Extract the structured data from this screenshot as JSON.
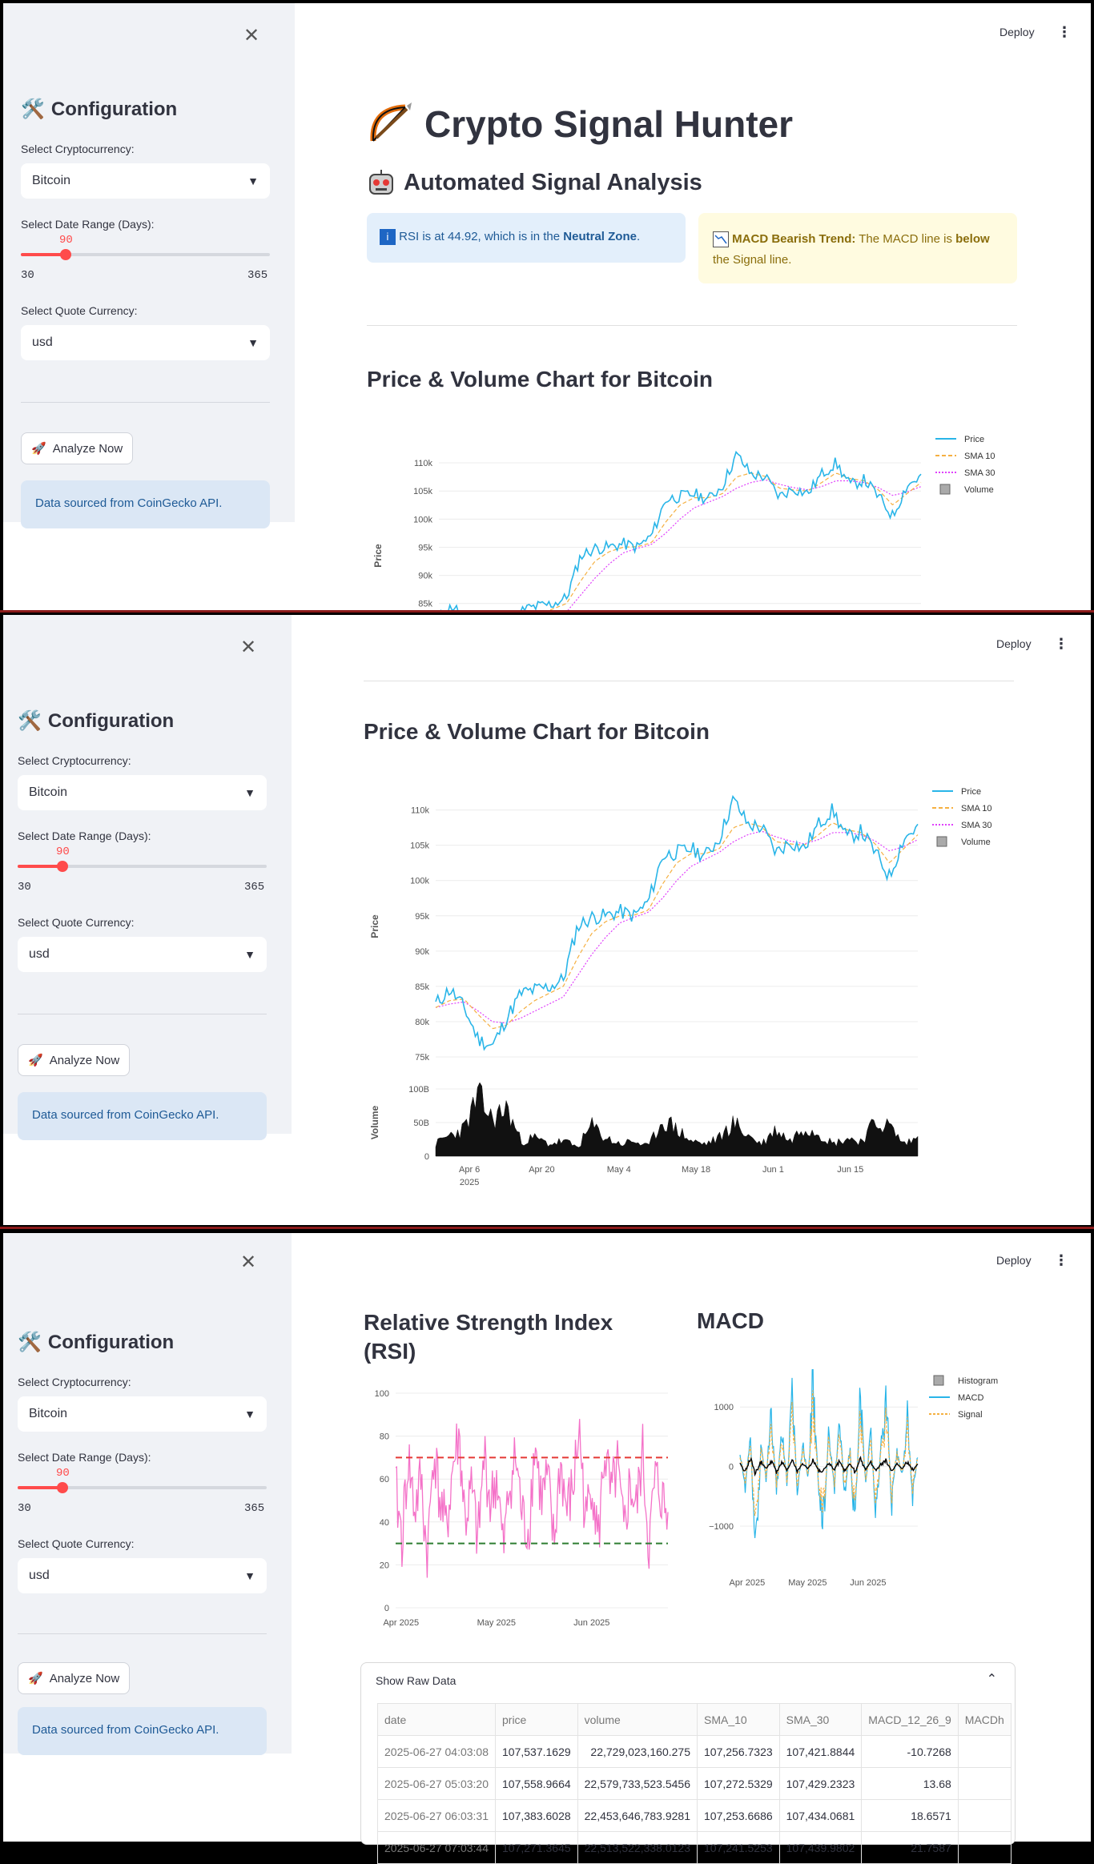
{
  "sidebar": {
    "title": "Configuration",
    "crypto_label": "Select Cryptocurrency:",
    "crypto_value": "Bitcoin",
    "range_label": "Select Date Range (Days):",
    "range_value": "90",
    "range_min": "30",
    "range_max": "365",
    "quote_label": "Select Quote Currency:",
    "quote_value": "usd",
    "analyze_button": "Analyze Now",
    "info": "Data sourced from CoinGecko API.",
    "close_icon": "close-icon"
  },
  "header": {
    "deploy": "Deploy",
    "menu_icon": "kebab-menu-icon"
  },
  "main": {
    "title": "Crypto Signal Hunter",
    "subtitle": "Automated Signal Analysis",
    "rsi_alert": {
      "pre": "RSI is at 44.92, which is in the ",
      "bold": "Neutral Zone",
      "post": "."
    },
    "macd_alert": {
      "bold": "MACD Bearish Trend:",
      "pre": " The MACD line is ",
      "bold2": "below",
      "post": " the Signal line."
    },
    "price_section_title": "Price & Volume Chart for Bitcoin",
    "rsi_title_line1": "Relative Strength Index",
    "rsi_title_line2": "(RSI)",
    "macd_title": "MACD"
  },
  "chart_data": [
    {
      "type": "line",
      "title": "Price & Volume Chart for Bitcoin",
      "ylabel": "Price",
      "ylim": [
        75000,
        112000
      ],
      "y_ticks": [
        "75k",
        "80k",
        "85k",
        "90k",
        "95k",
        "100k",
        "105k",
        "110k"
      ],
      "x_ticks": [
        "Apr 6",
        "Apr 20",
        "May 4",
        "May 18",
        "Jun 1",
        "Jun 15"
      ],
      "x_year": "2025",
      "legend": [
        "Price",
        "SMA 10",
        "SMA 30",
        "Volume"
      ],
      "legend_position": "top-right",
      "x": [
        "2025-03-29",
        "2025-04-01",
        "2025-04-04",
        "2025-04-06",
        "2025-04-08",
        "2025-04-09",
        "2025-04-12",
        "2025-04-15",
        "2025-04-18",
        "2025-04-21",
        "2025-04-22",
        "2025-04-25",
        "2025-04-28",
        "2025-05-01",
        "2025-05-04",
        "2025-05-06",
        "2025-05-08",
        "2025-05-11",
        "2025-05-14",
        "2025-05-17",
        "2025-05-20",
        "2025-05-22",
        "2025-05-25",
        "2025-05-28",
        "2025-05-31",
        "2025-06-03",
        "2025-06-05",
        "2025-06-08",
        "2025-06-10",
        "2025-06-13",
        "2025-06-16",
        "2025-06-19",
        "2025-06-22",
        "2025-06-24",
        "2025-06-27"
      ],
      "series": [
        {
          "name": "Price",
          "values": [
            82500,
            84600,
            82000,
            77500,
            76500,
            80500,
            84000,
            84500,
            84900,
            86000,
            93500,
            94800,
            95000,
            95600,
            95000,
            97000,
            103500,
            104000,
            104500,
            103500,
            106000,
            111500,
            108000,
            107500,
            104000,
            105500,
            104500,
            108000,
            110000,
            106000,
            107000,
            104000,
            100500,
            106000,
            107500
          ]
        },
        {
          "name": "SMA 10",
          "values": [
            82000,
            83000,
            83200,
            81000,
            79000,
            79500,
            81500,
            83000,
            84000,
            85000,
            89000,
            92500,
            94200,
            95000,
            95100,
            95800,
            99500,
            102500,
            103800,
            103800,
            104500,
            107500,
            108200,
            107600,
            105500,
            105200,
            105000,
            106500,
            108200,
            107200,
            106800,
            105200,
            102500,
            104500,
            106500
          ]
        },
        {
          "name": "SMA 30",
          "values": [
            82000,
            82500,
            82800,
            81500,
            80000,
            79800,
            80500,
            81500,
            82500,
            83500,
            86500,
            89500,
            92000,
            94000,
            94800,
            95500,
            97500,
            100000,
            102000,
            103000,
            104000,
            105500,
            106500,
            107000,
            106200,
            105600,
            105200,
            105800,
            106800,
            106800,
            106500,
            105600,
            104200,
            104800,
            105800
          ]
        }
      ],
      "volume": {
        "name": "Volume",
        "ylabel": "Volume",
        "ylim": [
          0,
          100
        ],
        "unit": "B",
        "y_ticks": [
          "0",
          "50B",
          "100B"
        ],
        "values": [
          20,
          35,
          45,
          98,
          60,
          80,
          25,
          30,
          20,
          25,
          15,
          50,
          30,
          20,
          25,
          15,
          60,
          45,
          25,
          20,
          30,
          55,
          35,
          20,
          45,
          25,
          50,
          40,
          20,
          30,
          25,
          55,
          50,
          20,
          30
        ]
      }
    },
    {
      "type": "line",
      "title": "Relative Strength Index (RSI)",
      "ylim": [
        0,
        100
      ],
      "y_ticks": [
        "0",
        "20",
        "40",
        "60",
        "80",
        "100"
      ],
      "x_ticks": [
        "Apr 2025",
        "May 2025",
        "Jun 2025"
      ],
      "overbought": 70,
      "oversold": 30,
      "series": [
        {
          "name": "RSI",
          "values": [
            55,
            32,
            70,
            45,
            60,
            22,
            75,
            50,
            35,
            65,
            80,
            40,
            55,
            30,
            72,
            48,
            62,
            25,
            58,
            70,
            42,
            35,
            78,
            50,
            60,
            28,
            68,
            45,
            55,
            85,
            38,
            62,
            30,
            74,
            50,
            66,
            33,
            58,
            45,
            72,
            28,
            60,
            52,
            40
          ]
        }
      ]
    },
    {
      "type": "line",
      "title": "MACD",
      "ylim": [
        -1700,
        1500
      ],
      "y_ticks": [
        "−1000",
        "0",
        "1000"
      ],
      "x_ticks": [
        "Apr 2025",
        "May 2025",
        "Jun 2025"
      ],
      "legend": [
        "Histogram",
        "MACD",
        "Signal"
      ],
      "legend_position": "top-right",
      "series": [
        {
          "name": "MACD",
          "values": [
            200,
            -300,
            500,
            -1600,
            300,
            -200,
            900,
            -400,
            600,
            -300,
            1300,
            -500,
            400,
            -200,
            1400,
            -300,
            -900,
            600,
            -400,
            900,
            -500,
            300,
            -1000,
            1200,
            -300,
            500,
            -900,
            400,
            1100,
            -600,
            300,
            -200,
            800,
            -500,
            200
          ]
        },
        {
          "name": "Signal",
          "values": [
            150,
            -200,
            350,
            -1100,
            250,
            -150,
            650,
            -300,
            450,
            -250,
            950,
            -350,
            300,
            -150,
            1000,
            -250,
            -650,
            450,
            -300,
            650,
            -350,
            250,
            -750,
            850,
            -250,
            350,
            -650,
            300,
            800,
            -450,
            250,
            -150,
            600,
            -350,
            150
          ]
        },
        {
          "name": "Histogram",
          "values": [
            50,
            -100,
            150,
            -150,
            100,
            -50,
            120,
            -100,
            80,
            -60,
            100,
            -80,
            60,
            -40,
            120,
            -70,
            -90,
            80,
            -60,
            100,
            -80,
            50,
            -100,
            120,
            -50,
            80,
            -90,
            60,
            100,
            -80,
            50,
            -40,
            90,
            -70,
            40
          ]
        }
      ]
    }
  ],
  "raw_data": {
    "toggle_label": "Show Raw Data",
    "columns": [
      "date",
      "price",
      "volume",
      "SMA_10",
      "SMA_30",
      "MACD_12_26_9",
      "MACDh"
    ],
    "rows": [
      [
        "2025-06-27 04:03:08",
        "107,537.1629",
        "22,729,023,160.275",
        "107,256.7323",
        "107,421.8844",
        "-10.7268",
        ""
      ],
      [
        "2025-06-27 05:03:20",
        "107,558.9664",
        "22,579,733,523.5456",
        "107,272.5329",
        "107,429.2323",
        "13.68",
        ""
      ],
      [
        "2025-06-27 06:03:31",
        "107,383.6028",
        "22,453,646,783.9281",
        "107,253.6686",
        "107,434.0681",
        "18.6571",
        ""
      ],
      [
        "2025-06-27 07:03:44",
        "107,271.3645",
        "22,513,522,338.0123",
        "107,241.5253",
        "107,439.9802",
        "21.7587",
        ""
      ]
    ]
  },
  "colors": {
    "price": "#29b5e8",
    "sma10": "#f5b041",
    "sma30": "#e040fb",
    "volume": "#111111",
    "rsi": "#f472c8",
    "overbought": "#e53935",
    "oversold": "#2e7d32",
    "accent": "#ff4b4b",
    "macd": "#29b5e8",
    "signal": "#f5b041",
    "histogram": "#000000"
  }
}
